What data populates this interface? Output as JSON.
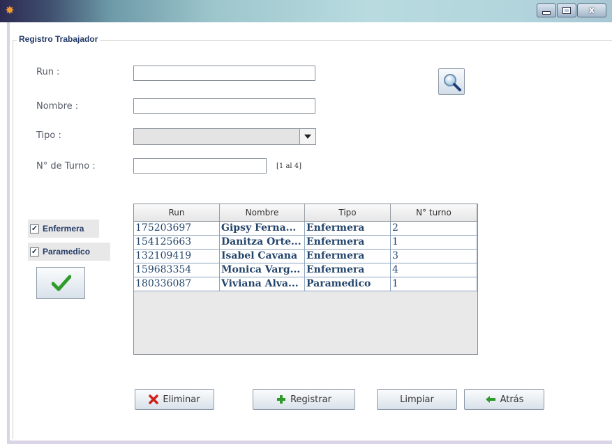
{
  "window": {
    "app_icon": "orange-asterisk-icon",
    "controls": [
      "minimize",
      "maximize",
      "close"
    ],
    "close_label": "X"
  },
  "group": {
    "title": "Registro Trabajador"
  },
  "form": {
    "run_label": "Run :",
    "run_value": "",
    "nombre_label": "Nombre :",
    "nombre_value": "",
    "tipo_label": "Tipo :",
    "tipo_value": "",
    "turno_label": "N° de Turno :",
    "turno_value": "",
    "turno_hint": "[1 al 4]"
  },
  "filters": [
    {
      "label": "Enfermera",
      "checked": true
    },
    {
      "label": "Paramedico",
      "checked": true
    }
  ],
  "table": {
    "headers": [
      "Run",
      "Nombre",
      "Tipo",
      "N° turno"
    ],
    "rows": [
      [
        "175203697",
        "Gipsy Ferna...",
        "Enfermera",
        "2"
      ],
      [
        "154125663",
        "Danitza Orte...",
        "Enfermera",
        "1"
      ],
      [
        "132109419",
        "Isabel Cavana",
        "Enfermera",
        "3"
      ],
      [
        "159683354",
        "Monica Varg...",
        "Enfermera",
        "4"
      ],
      [
        "180336087",
        "Viviana Alva...",
        "Paramedico",
        "1"
      ]
    ]
  },
  "buttons": {
    "eliminar": "Eliminar",
    "registrar": "Registrar",
    "limpiar": "Limpiar",
    "atras": "Atrás"
  },
  "colors": {
    "accent_text": "#233a66",
    "table_text": "#24456b",
    "delete_red": "#d0201a",
    "add_green": "#2e9a2a"
  }
}
